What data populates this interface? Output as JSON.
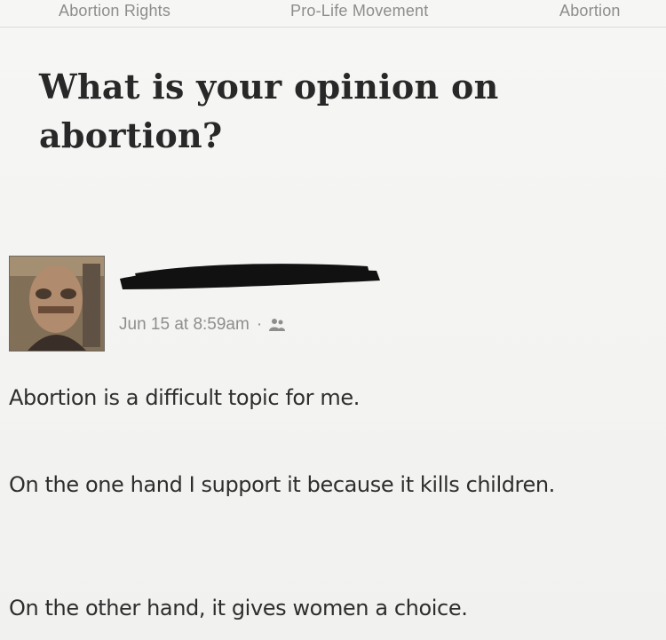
{
  "topics": [
    "Abortion Rights",
    "Pro-Life Movement",
    "Abortion"
  ],
  "question": {
    "title": "What is your opinion on abortion?"
  },
  "answer": {
    "author": {
      "name_redacted": true,
      "avatar_icon": "user-avatar-photo"
    },
    "timestamp": "Jun 15 at 8:59am",
    "meta_separator": "·",
    "visibility_icon": "people-icon",
    "paragraphs": [
      "Abortion is a difficult topic for me.",
      "On the one hand I support it because it kills children.",
      "On the other hand, it gives women a choice."
    ]
  },
  "colors": {
    "background": "#f3f3f1",
    "title_text": "#282828",
    "body_text": "#2e2e2e",
    "muted_text": "#8e8e8e",
    "redaction": "#111111"
  }
}
